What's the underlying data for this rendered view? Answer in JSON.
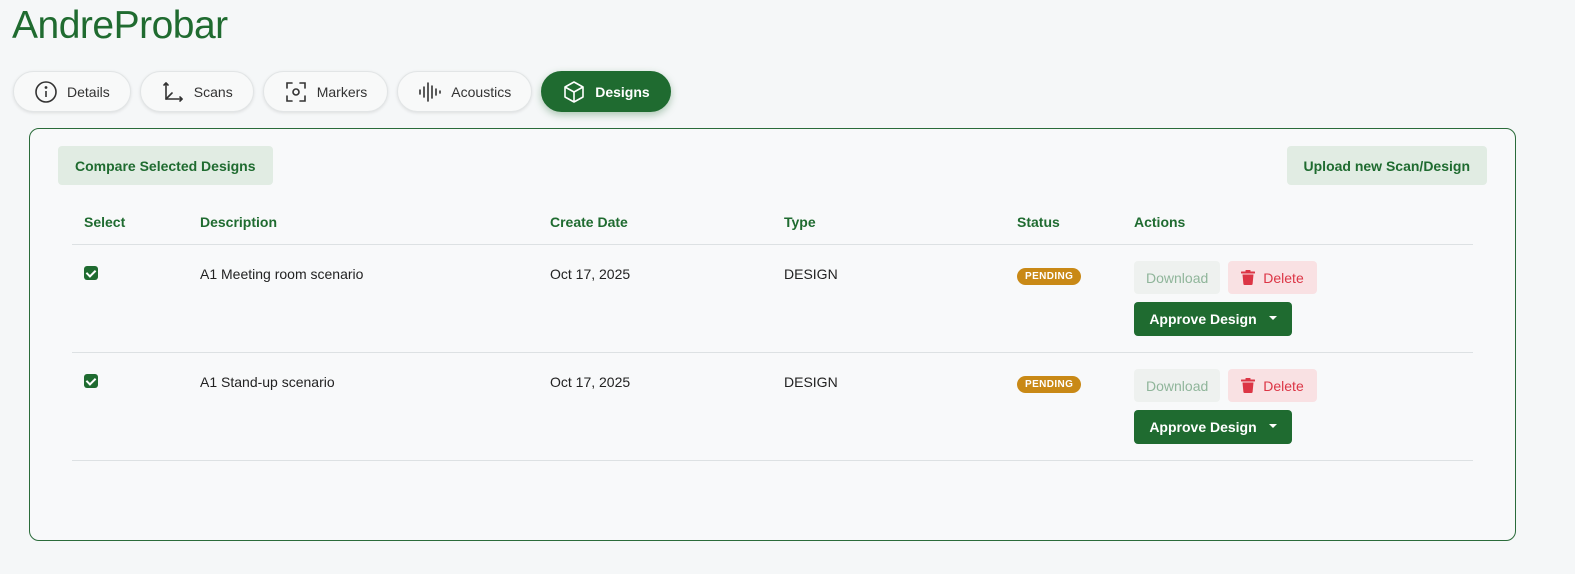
{
  "app": {
    "title": "AndreProbar"
  },
  "tabs": [
    {
      "label": "Details",
      "icon": "info-icon"
    },
    {
      "label": "Scans",
      "icon": "axes-icon"
    },
    {
      "label": "Markers",
      "icon": "scan-target-icon"
    },
    {
      "label": "Acoustics",
      "icon": "waveform-icon"
    },
    {
      "label": "Designs",
      "icon": "cube-icon",
      "active": true
    }
  ],
  "toolbar": {
    "compare_label": "Compare Selected Designs",
    "upload_label": "Upload new Scan/Design"
  },
  "table": {
    "headers": [
      "Select",
      "Description",
      "Create Date",
      "Type",
      "Status",
      "Actions"
    ],
    "rows": [
      {
        "selected": true,
        "description": "A1 Meeting room scenario",
        "create_date": "Oct 17, 2025",
        "type": "DESIGN",
        "status": "PENDING"
      },
      {
        "selected": true,
        "description": "A1 Stand-up scenario",
        "create_date": "Oct 17, 2025",
        "type": "DESIGN",
        "status": "PENDING"
      }
    ]
  },
  "actions": {
    "download_label": "Download",
    "delete_label": "Delete",
    "approve_label": "Approve Design"
  },
  "colors": {
    "brand": "#1f6b30",
    "pending": "#c98916",
    "danger": "#dc3545"
  }
}
